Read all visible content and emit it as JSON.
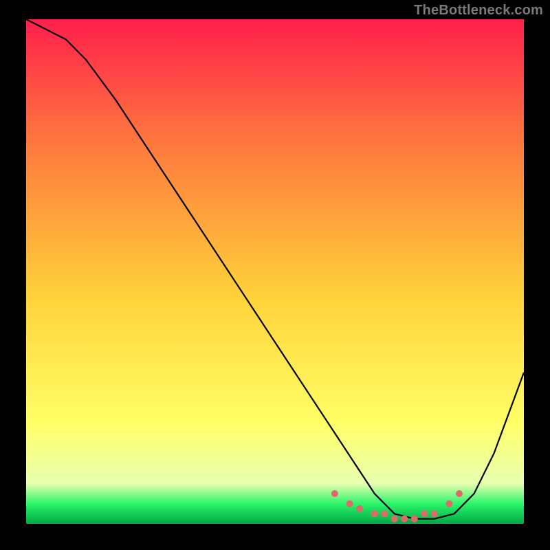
{
  "watermark": "TheBottleneck.com",
  "chart_data": {
    "type": "line",
    "title": "",
    "xlabel": "",
    "ylabel": "",
    "xlim": [
      0,
      100
    ],
    "ylim": [
      0,
      100
    ],
    "gradient_colors": {
      "top": "#ff1f4b",
      "upper_mid": "#ff7a3e",
      "mid": "#ffd23a",
      "lower_mid": "#ffff66",
      "green_band": "#2bf56a",
      "bottom_edge": "#00a844"
    },
    "background_bands_pct_from_top": [
      {
        "stop": 0,
        "color": "#ff1f4b"
      },
      {
        "stop": 25,
        "color": "#ff7a3e"
      },
      {
        "stop": 55,
        "color": "#ffd23a"
      },
      {
        "stop": 80,
        "color": "#ffff66"
      },
      {
        "stop": 92,
        "color": "#e8ffb0"
      },
      {
        "stop": 96,
        "color": "#2bf56a"
      },
      {
        "stop": 100,
        "color": "#00a844"
      }
    ],
    "series": [
      {
        "name": "curve",
        "x": [
          0,
          4,
          8,
          12,
          18,
          26,
          34,
          42,
          50,
          58,
          62,
          66,
          70,
          74,
          78,
          82,
          86,
          90,
          94,
          100
        ],
        "y": [
          100,
          98,
          96,
          92,
          84,
          72,
          60,
          48,
          36,
          24,
          18,
          12,
          6,
          2,
          1,
          1,
          2,
          6,
          14,
          30
        ]
      }
    ],
    "markers": {
      "name": "highlight-dots",
      "color": "#e06a6a",
      "x": [
        62,
        65,
        67,
        70,
        72,
        74,
        76,
        78,
        80,
        82,
        85,
        87
      ],
      "y": [
        6,
        4,
        3,
        2,
        2,
        1,
        1,
        1,
        2,
        2,
        4,
        6
      ]
    }
  }
}
